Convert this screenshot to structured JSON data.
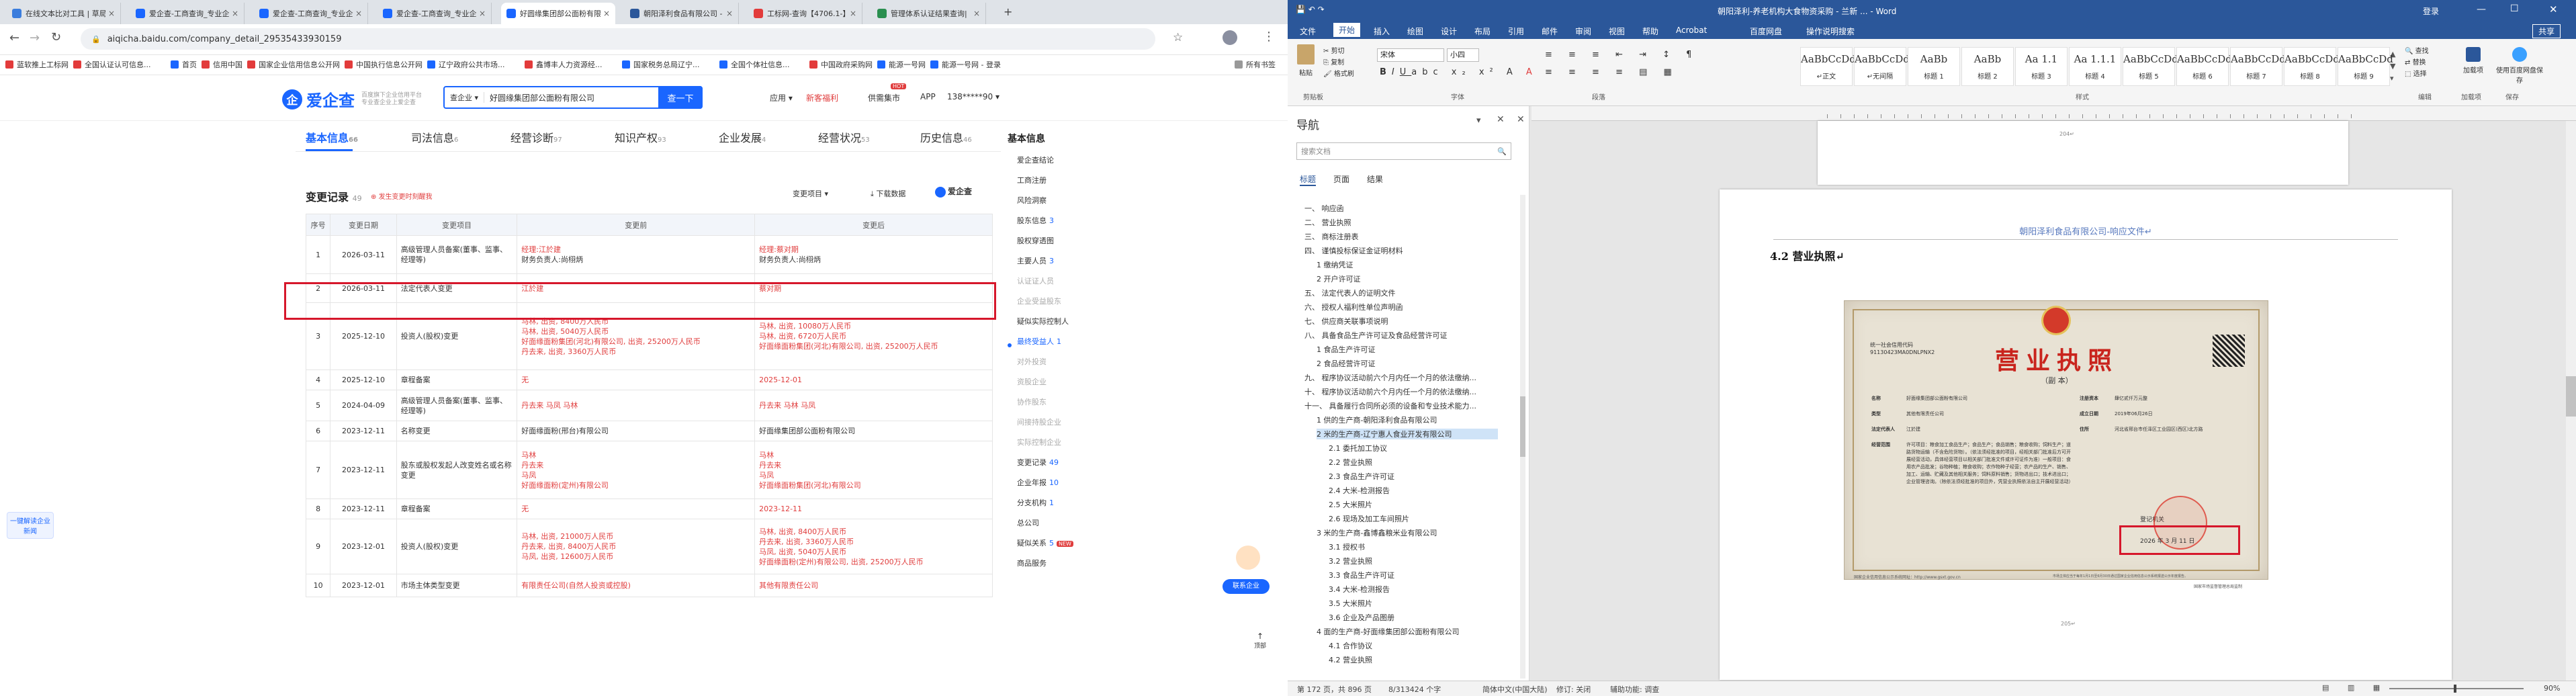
{
  "browser": {
    "tabs": [
      {
        "label": "在线文本比对工具 | 草局",
        "color": "#3b7ddd"
      },
      {
        "label": "爱企查-工商查询_专业企",
        "color": "#1a66ff"
      },
      {
        "label": "爱企查-工商查询_专业企",
        "color": "#1a66ff"
      },
      {
        "label": "爱企查-工商查询_专业企",
        "color": "#1a66ff"
      },
      {
        "label": "好圆缘集团部公面粉有限",
        "color": "#1a66ff"
      },
      {
        "label": "朝阳泽利食品有限公司 - ",
        "color": "#2b579a"
      },
      {
        "label": "工标网-查询【4706.1-】",
        "color": "#e23b3b"
      },
      {
        "label": "管理体系认证结果查询|",
        "color": "#2a8f4f"
      }
    ],
    "url": "aiqicha.baidu.com/company_detail_29535433930159",
    "bookmarks": [
      "蓝软推上工标网",
      "全国认证认可信息...",
      "首页",
      "信用中国",
      "国家企业信用信息公开网",
      "中国执行信息公开网",
      "辽宁政府公共市场...",
      "鑫博丰人力资源经...",
      "国家税务总局辽宁...",
      "全国个体社信息...",
      "中国政府采购网",
      "能源一号网",
      "能源一号网 - 登录",
      "所有书签"
    ],
    "bookmark_colors": [
      "#e23b3b",
      "#e23b3b",
      "#1a66ff",
      "#e23b3b",
      "#e23b3b",
      "#e23b3b",
      "#1a66ff",
      "#e23b3b",
      "#1a66ff",
      "#1a66ff",
      "#e23b3b",
      "#1a66ff",
      "#1a66ff",
      "#999999"
    ]
  },
  "site": {
    "logo_text": "爱企查",
    "logo_sub1": "百度旗下企业信用平台",
    "logo_sub2": "专业查企业上爱企查",
    "search_scope": "查企业 ▾",
    "search_value": "好圆缘集团部公面粉有限公司",
    "search_button": "查一下",
    "header_links": [
      "应用 ▾",
      "新客福利",
      "供需集市",
      "APP",
      "138*****90 ▾"
    ],
    "hot_badge": "HOT",
    "nav": [
      {
        "label": "基本信息",
        "count": "66"
      },
      {
        "label": "司法信息",
        "count": "6"
      },
      {
        "label": "经营诊断",
        "count": "97"
      },
      {
        "label": "知识产权",
        "count": "93"
      },
      {
        "label": "企业发展",
        "count": "4"
      },
      {
        "label": "经营状况",
        "count": "53"
      },
      {
        "label": "历史信息",
        "count": "46"
      }
    ],
    "section_title": "变更记录",
    "section_count": "49",
    "section_hint": "发生变更时刻醒我",
    "filter_label": "变更项目 ▾",
    "download_label": "下载数据",
    "brand_label": "爱企查",
    "table_headers": [
      "序号",
      "变更日期",
      "变更项目",
      "变更前",
      "变更后"
    ],
    "rows": [
      {
        "no": "1",
        "date": "2026-03-11",
        "item": "高级管理人员备案(董事、监事、经理等)",
        "before": "经理:江於建\n财务负责人:尚栩炳",
        "after": "经理:蔡对期\n财务负责人:尚栩炳"
      },
      {
        "no": "2",
        "date": "2026-03-11",
        "item": "法定代表人变更",
        "before": "江於建",
        "after": "蔡对期"
      },
      {
        "no": "3",
        "date": "2025-12-10",
        "item": "投资人(股权)变更",
        "before": "马林, 出资, 8400万人民币\n马林, 出资, 5040万人民币\n好面缘面粉集团(河北)有限公司, 出资, 25200万人民币\n丹去来, 出资, 3360万人民币",
        "after": "马林, 出资, 10080万人民币\n马林, 出资, 6720万人民币\n好面缘面粉集团(河北)有限公司, 出资, 25200万人民币"
      },
      {
        "no": "4",
        "date": "2025-12-10",
        "item": "章程备案",
        "before": "无",
        "after": "2025-12-01"
      },
      {
        "no": "5",
        "date": "2024-04-09",
        "item": "高级管理人员备案(董事、监事、经理等)",
        "before": "丹去来 马凤 马林",
        "after": "丹去来 马林 马凤"
      },
      {
        "no": "6",
        "date": "2023-12-11",
        "item": "名称变更",
        "before": "好面缘面粉(邢台)有限公司",
        "after": "好面缘集团部公面粉有限公司"
      },
      {
        "no": "7",
        "date": "2023-12-11",
        "item": "股东或股权发起人改变姓名或名称变更",
        "before": "马林\n丹去来\n马凤\n好面缘面粉(定州)有限公司",
        "after": "马林\n丹去来\n马凤\n好面缘面粉集团(河北)有限公司"
      },
      {
        "no": "8",
        "date": "2023-12-11",
        "item": "章程备案",
        "before": "无",
        "after": "2023-12-11"
      },
      {
        "no": "9",
        "date": "2023-12-01",
        "item": "投资人(股权)变更",
        "before": "马林, 出资, 21000万人民币\n丹去来, 出资, 8400万人民币\n马凤, 出资, 12600万人民币",
        "after": "马林, 出资, 8400万人民币\n丹去来, 出资, 3360万人民币\n马凤, 出资, 5040万人民币\n好面缘面粉(定州)有限公司, 出资, 25200万人民币"
      },
      {
        "no": "10",
        "date": "2023-12-01",
        "item": "市场主体类型变更",
        "before": "有限责任公司(自然人投资或控股)",
        "after": "其他有限责任公司"
      }
    ],
    "right_menu_title": "基本信息",
    "right_menu": [
      {
        "label": "爱企查结论",
        "count": ""
      },
      {
        "label": "工商注册",
        "count": ""
      },
      {
        "label": "风险洞察",
        "count": ""
      },
      {
        "label": "股东信息",
        "count": "3"
      },
      {
        "label": "股权穿透图",
        "count": ""
      },
      {
        "label": "主要人员",
        "count": "3"
      },
      {
        "label": "认证证人员",
        "count": ""
      },
      {
        "label": "企业受益股东",
        "count": ""
      },
      {
        "label": "疑似实际控制人",
        "count": ""
      },
      {
        "label": "最终受益人",
        "count": "1"
      },
      {
        "label": "对外投资",
        "count": ""
      },
      {
        "label": "资股企业",
        "count": ""
      },
      {
        "label": "协作股东",
        "count": ""
      },
      {
        "label": "间接持股企业",
        "count": ""
      },
      {
        "label": "实际控制企业",
        "count": ""
      },
      {
        "label": "变更记录",
        "count": "49"
      },
      {
        "label": "企业年报",
        "count": "10"
      },
      {
        "label": "分支机构",
        "count": "1"
      },
      {
        "label": "总公司",
        "count": ""
      },
      {
        "label": "疑似关系",
        "count": "5"
      },
      {
        "label": "商品服务",
        "count": ""
      }
    ],
    "new_badge": "NEW",
    "left_float": "一键解读企业新闻",
    "contact_label": "联系企业",
    "top_label": "顶部"
  },
  "word": {
    "title": "朝阳泽利-养老机构大食物资采购 - 兰新 ... - Word",
    "user": "登录",
    "share": "共享",
    "tabs": [
      "文件",
      "开始",
      "插入",
      "绘图",
      "设计",
      "布局",
      "引用",
      "邮件",
      "审阅",
      "视图",
      "帮助",
      "Acrobat",
      "百度网盘",
      "操作说明搜索"
    ],
    "font_name": "宋体",
    "font_size": "小四",
    "clipboard_items": [
      "剪切",
      "复制",
      "格式刷"
    ],
    "paste_label": "粘贴",
    "styles": [
      {
        "preview": "AaBbCcDd",
        "name": "↵正文"
      },
      {
        "preview": "AaBbCcDd",
        "name": "↵无间隔"
      },
      {
        "preview": "AaBb",
        "name": "标题 1"
      },
      {
        "preview": "AaBb",
        "name": "标题 2"
      },
      {
        "preview": "Aa 1.1",
        "name": "标题 3"
      },
      {
        "preview": "Aa 1.1.1",
        "name": "标题 4"
      },
      {
        "preview": "AaBbCcDd",
        "name": "标题 5"
      },
      {
        "preview": "AaBbCcDd",
        "name": "标题 6"
      },
      {
        "preview": "AaBbCcDd",
        "name": "标题 7"
      },
      {
        "preview": "AaBbCcDd",
        "name": "标题 8"
      },
      {
        "preview": "AaBbCcDd",
        "name": "标题 9"
      }
    ],
    "right_tools": [
      "查找",
      "替换",
      "选择",
      "加载项",
      "使用百度网盘保存"
    ],
    "groups": [
      "剪贴板",
      "字体",
      "段落",
      "样式",
      "编辑",
      "加载项",
      "保存"
    ],
    "nav_title": "导航",
    "nav_search_placeholder": "搜索文档",
    "nav_tabs": [
      "标题",
      "页面",
      "结果"
    ],
    "nav_items": [
      {
        "t": "一、 响应函",
        "lv": 1
      },
      {
        "t": "二、 营业执照",
        "lv": 1
      },
      {
        "t": "三、 商标注册表",
        "lv": 1
      },
      {
        "t": "四、 谨慎投标保证金证明材料",
        "lv": 1
      },
      {
        "t": "1 缴纳凭证",
        "lv": 2
      },
      {
        "t": "2 开户许可证",
        "lv": 2
      },
      {
        "t": "五、 法定代表人的证明文件",
        "lv": 1
      },
      {
        "t": "六、 授权人福利性单位声明函",
        "lv": 1
      },
      {
        "t": "七、 供应商关联事项说明",
        "lv": 1
      },
      {
        "t": "八、 具备食品生产许可证及食品经营许可证",
        "lv": 1
      },
      {
        "t": "1 食品生产许可证",
        "lv": 2
      },
      {
        "t": "2 食品经营许可证",
        "lv": 2
      },
      {
        "t": "九、 程序协议活动前六个月内任一个月的依法缴纳...",
        "lv": 1
      },
      {
        "t": "十、 程序协议活动前六个月内任一个月的依法缴纳...",
        "lv": 1
      },
      {
        "t": "十一、 具备履行合同所必须的设备和专业技术能力...",
        "lv": 1
      },
      {
        "t": "1 供的生产商-朝阳泽利食品有限公司",
        "lv": 2
      },
      {
        "t": "2 米的生产商-辽宁惠人食业开发有限公司",
        "lv": 2,
        "sel": true
      },
      {
        "t": "2.1 委托加工协议",
        "lv": 3
      },
      {
        "t": "2.2 营业执照",
        "lv": 3
      },
      {
        "t": "2.3 食品生产许可证",
        "lv": 3
      },
      {
        "t": "2.4 大米-检测报告",
        "lv": 3
      },
      {
        "t": "2.5 大米照片",
        "lv": 3
      },
      {
        "t": "2.6 现场及加工车间照片",
        "lv": 3
      },
      {
        "t": "3 米的生产商-鑫博鑫粮米业有限公司",
        "lv": 2
      },
      {
        "t": "3.1 授权书",
        "lv": 3
      },
      {
        "t": "3.2 营业执照",
        "lv": 3
      },
      {
        "t": "3.3 食品生产许可证",
        "lv": 3
      },
      {
        "t": "3.4 大米-检测报告",
        "lv": 3
      },
      {
        "t": "3.5 大米照片",
        "lv": 3
      },
      {
        "t": "3.6 企业及产品图册",
        "lv": 3
      },
      {
        "t": "4 面的生产商-好面缘集团部公面粉有限公司",
        "lv": 2
      },
      {
        "t": "4.1 合作协议",
        "lv": 3
      },
      {
        "t": "4.2 营业执照",
        "lv": 3
      }
    ],
    "doc_header": "朝阳泽利食品有限公司-响应文件↵",
    "heading": "4.2 营业执照↵",
    "page_marker1": "204↵",
    "page_marker2": "205↵",
    "license_title": "营业执照",
    "license_sub": "（副 本）",
    "license_code": "统一社会信用代码",
    "license_code_value": "91130423MA0DNLPNX2",
    "license_fields": [
      {
        "k": "名称",
        "v": "好面缘集团部公面粉有限公司"
      },
      {
        "k": "类型",
        "v": "其他有限责任公司"
      },
      {
        "k": "法定代表人",
        "v": "江於建"
      },
      {
        "k": "经营范围",
        "v": "许可项目：粮食加工食品生产；食品生产；食品销售；粮食收购；饲料生产；道路货物运输（不含危险货物）。（依法须经批准的项目，经相关部门批准后方可开展经营活动，具体经营项目以相关部门批准文件或许可证件为准）一般项目：食用农产品批发；谷物种植；粮食收购；农作物种子经营；农产品的生产、销售、加工、运输、贮藏及其他相关服务；饲料原料销售；货物进出口；技术进出口；企业管理咨询。（除依法须经批准的项目外，凭营业执照依法自主开展经营活动）"
      }
    ],
    "license_fields_right": [
      {
        "k": "注册资本",
        "v": "肆亿贰仟万元整"
      },
      {
        "k": "成立日期",
        "v": "2019年06月26日"
      },
      {
        "k": "住所",
        "v": "河北省邢台市任泽区工业园区(西区)北方路"
      }
    ],
    "license_authority": "登记机关",
    "license_date": "2026   年   3   月   11   日",
    "license_foot_left": "国家企业信用信息公示系统网址：http://www.gsxt.gov.cn",
    "license_foot_mid": "市场主体应当于每年1月1日至6月30日通过国家企业信用信息公示系统报送公示年度报告。",
    "license_foot_right": "国家市场监督管理总局监制",
    "status": {
      "page": "第 172 页，共 896 页",
      "words": "8/313424 个字",
      "lang": "简体中文(中国大陆)",
      "track": "修订: 关闭",
      "access": "辅助功能: 调查",
      "zoom": "90%"
    }
  },
  "colors": {
    "accent": "#1a66ff",
    "highlight": "#d6172b",
    "word_blue": "#2b579a",
    "red_text": "#e03d3d"
  }
}
